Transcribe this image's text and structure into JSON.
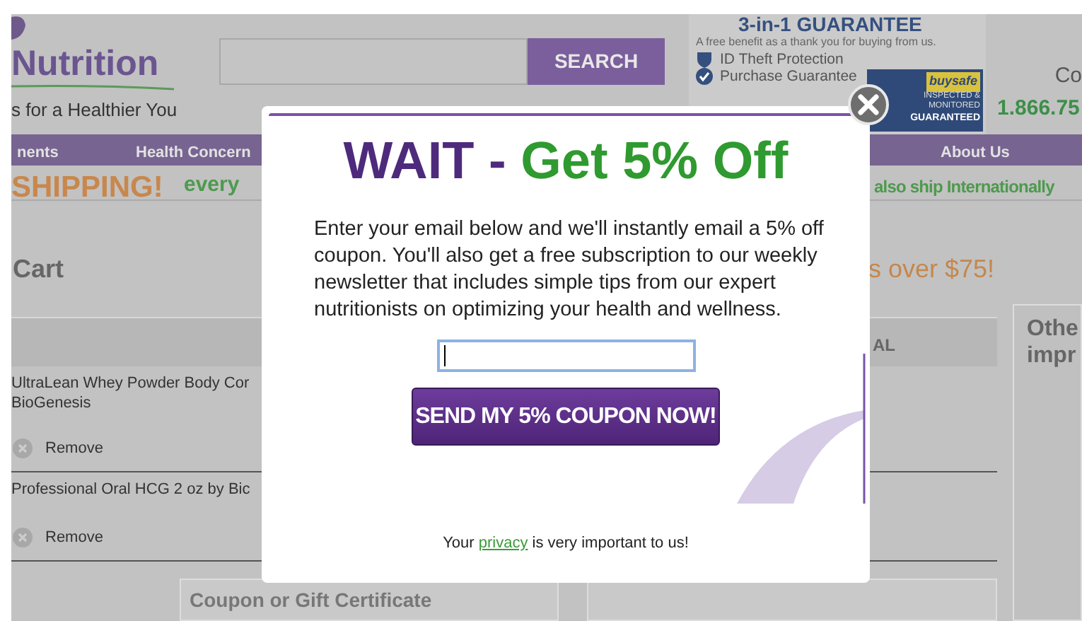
{
  "header": {
    "logo_text": "Nutrition",
    "tagline": "s for a Healthier You",
    "search_button": "SEARCH"
  },
  "guarantee": {
    "title": "3-in-1 GUARANTEE",
    "subtitle": "A free benefit as a thank you for buying from us.",
    "items": [
      "ID Theft Protection",
      "Purchase Guarantee"
    ],
    "badge": {
      "brand": "buysafe",
      "note": "INSPECTED & MONITORED",
      "status": "GUARANTEED"
    }
  },
  "contact": {
    "label": "Co",
    "phone": "1.866.75"
  },
  "nav": [
    "nents",
    "Health Concern",
    "About Us"
  ],
  "promo": {
    "highlight": "SHIPPING!",
    "left_text": "every",
    "right_text": "also ship Internationally"
  },
  "cart": {
    "title": "Cart",
    "free_shipping": "s over $75!",
    "column_header": "AL",
    "items": [
      {
        "name": "UltraLean Whey Powder Body Cor",
        "brand": "BioGenesis",
        "remove": "Remove"
      },
      {
        "name": "Professional Oral HCG 2 oz by Bic",
        "remove": "Remove"
      }
    ],
    "coupon": "Coupon or Gift Certificate"
  },
  "sidebar": {
    "title_lines": [
      "Othe",
      "impr"
    ]
  },
  "popup": {
    "title_lead": "WAIT -",
    "title_offer": "Get 5% Off",
    "body": "Enter your email below and we'll instantly email a 5% off coupon. You'll also get a free subscription to our weekly newsletter that includes simple tips from our expert nutritionists on optimizing your health and wellness.",
    "email_field": {
      "focused": true
    },
    "button": "SEND MY 5% COUPON NOW!",
    "footer": {
      "before": "Your",
      "link": "privacy",
      "after": "is very important to us!"
    }
  }
}
